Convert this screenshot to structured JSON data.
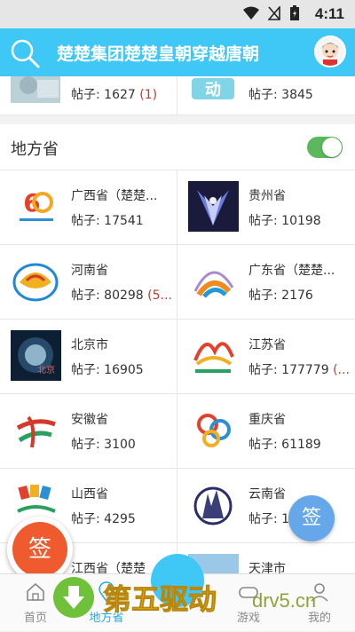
{
  "status_bar": {
    "time": "4:11"
  },
  "header": {
    "title": "楚楚集团楚楚皇朝穿越唐朝"
  },
  "top_row": [
    {
      "posts_label": "帖子: 1627",
      "new_count": "(1)"
    },
    {
      "posts_label": "帖子: 3845",
      "new_count": ""
    }
  ],
  "section": {
    "label": "地方省",
    "toggle_on": true
  },
  "provinces": [
    {
      "name": "广西省（楚楚...",
      "posts": "帖子: 17541",
      "new": ""
    },
    {
      "name": "贵州省",
      "posts": "帖子: 10198",
      "new": ""
    },
    {
      "name": "河南省",
      "posts": "帖子: 80298",
      "new": "(5..."
    },
    {
      "name": "广东省（楚楚...",
      "posts": "帖子: 2176",
      "new": ""
    },
    {
      "name": "北京市",
      "posts": "帖子: 16905",
      "new": ""
    },
    {
      "name": "江苏省",
      "posts": "帖子: 177779",
      "new": "(..."
    },
    {
      "name": "安徽省",
      "posts": "帖子: 3100",
      "new": ""
    },
    {
      "name": "重庆省",
      "posts": "帖子: 61189",
      "new": ""
    },
    {
      "name": "山西省",
      "posts": "帖子: 4295",
      "new": ""
    },
    {
      "name": "云南省",
      "posts": "帖子: 1",
      "new": ""
    },
    {
      "name": "江西省（楚楚",
      "posts": "",
      "new": ""
    },
    {
      "name": "天津市",
      "posts": "",
      "new": ""
    }
  ],
  "fabs": {
    "sign_left": "签",
    "sign_right": "签"
  },
  "bottom_nav": [
    {
      "label": "首页",
      "icon": "home-icon"
    },
    {
      "label": "地方省",
      "icon": "location-icon"
    },
    {
      "label": "",
      "icon": "center-icon"
    },
    {
      "label": "游戏",
      "icon": "game-icon"
    },
    {
      "label": "我的",
      "icon": "user-icon"
    }
  ],
  "watermark": {
    "text": "第五驱动",
    "url": "drv5.cn"
  },
  "colors": {
    "header": "#3fc7f5",
    "accent": "#2aa8e0",
    "new_count": "#c0392b",
    "toggle": "#5cb85c"
  }
}
